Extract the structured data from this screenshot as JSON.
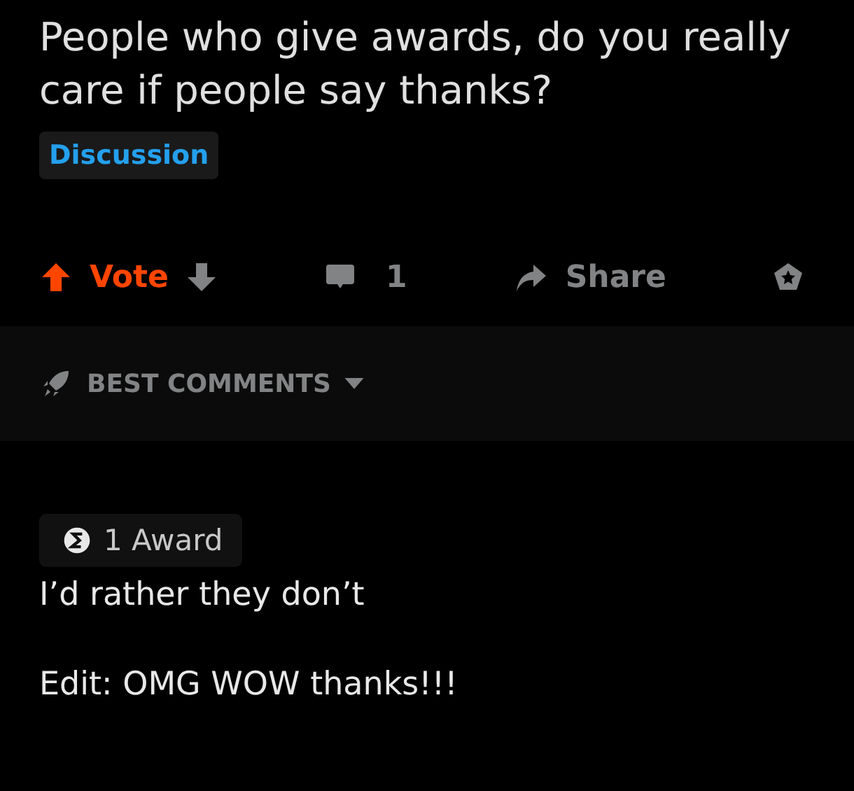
{
  "post": {
    "title": "People who give awards, do you really care if people say thanks?",
    "flair": "Discussion"
  },
  "actions": {
    "vote_label": "Vote",
    "upvoted": true,
    "downvoted": false,
    "comment_count": "1",
    "share_label": "Share"
  },
  "sort": {
    "label": "BEST COMMENTS"
  },
  "comment": {
    "award": "1 Award",
    "lines": [
      "I’d rather they don’t",
      "Edit: OMG WOW thanks!!!"
    ]
  }
}
